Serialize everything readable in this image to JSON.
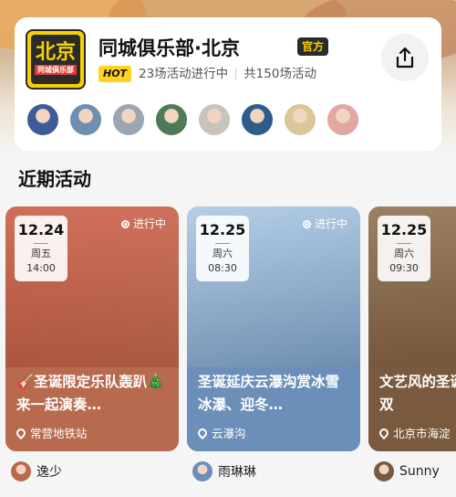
{
  "club": {
    "logo_text_big": "北京",
    "logo_text_small": "同城俱乐部",
    "name": "同城俱乐部·北京",
    "official_badge": "官方",
    "hot_badge": "HOT",
    "ongoing": "23场活动进行中",
    "total": "共150场活动",
    "share_icon": "share-icon"
  },
  "members": [
    {
      "color": "#3b5b9a"
    },
    {
      "color": "#6d8fb0"
    },
    {
      "color": "#9aa7b3"
    },
    {
      "color": "#4f7a5a"
    },
    {
      "color": "#c9c3bd"
    },
    {
      "color": "#2f5d8a"
    },
    {
      "color": "#d9c79a"
    },
    {
      "color": "#e0a8a0"
    }
  ],
  "section_title": "近期活动",
  "events": [
    {
      "date": "12.24",
      "weekday": "周五",
      "time": "14:00",
      "status": "进行中",
      "title": "🎸圣诞限定乐队轰趴🎄来一起演奏…",
      "location": "常营地铁站",
      "organizer": "逸少",
      "theme_color": "#c9543b",
      "caption_color": "#b86a4f"
    },
    {
      "date": "12.25",
      "weekday": "周六",
      "time": "08:30",
      "status": "进行中",
      "title": "圣诞延庆云瀑沟赏冰雪冰瀑、迎冬…",
      "location": "云瀑沟",
      "organizer": "雨琳琳",
      "theme_color": "#a8c6e3",
      "caption_color": "#6b8fb8"
    },
    {
      "date": "12.25",
      "weekday": "周六",
      "time": "09:30",
      "status": "",
      "title": "文艺风的圣诞清华艺博双",
      "location": "北京市海淀",
      "organizer": "Sunny",
      "theme_color": "#8a6a4a",
      "caption_color": "#7a5a3e"
    }
  ]
}
